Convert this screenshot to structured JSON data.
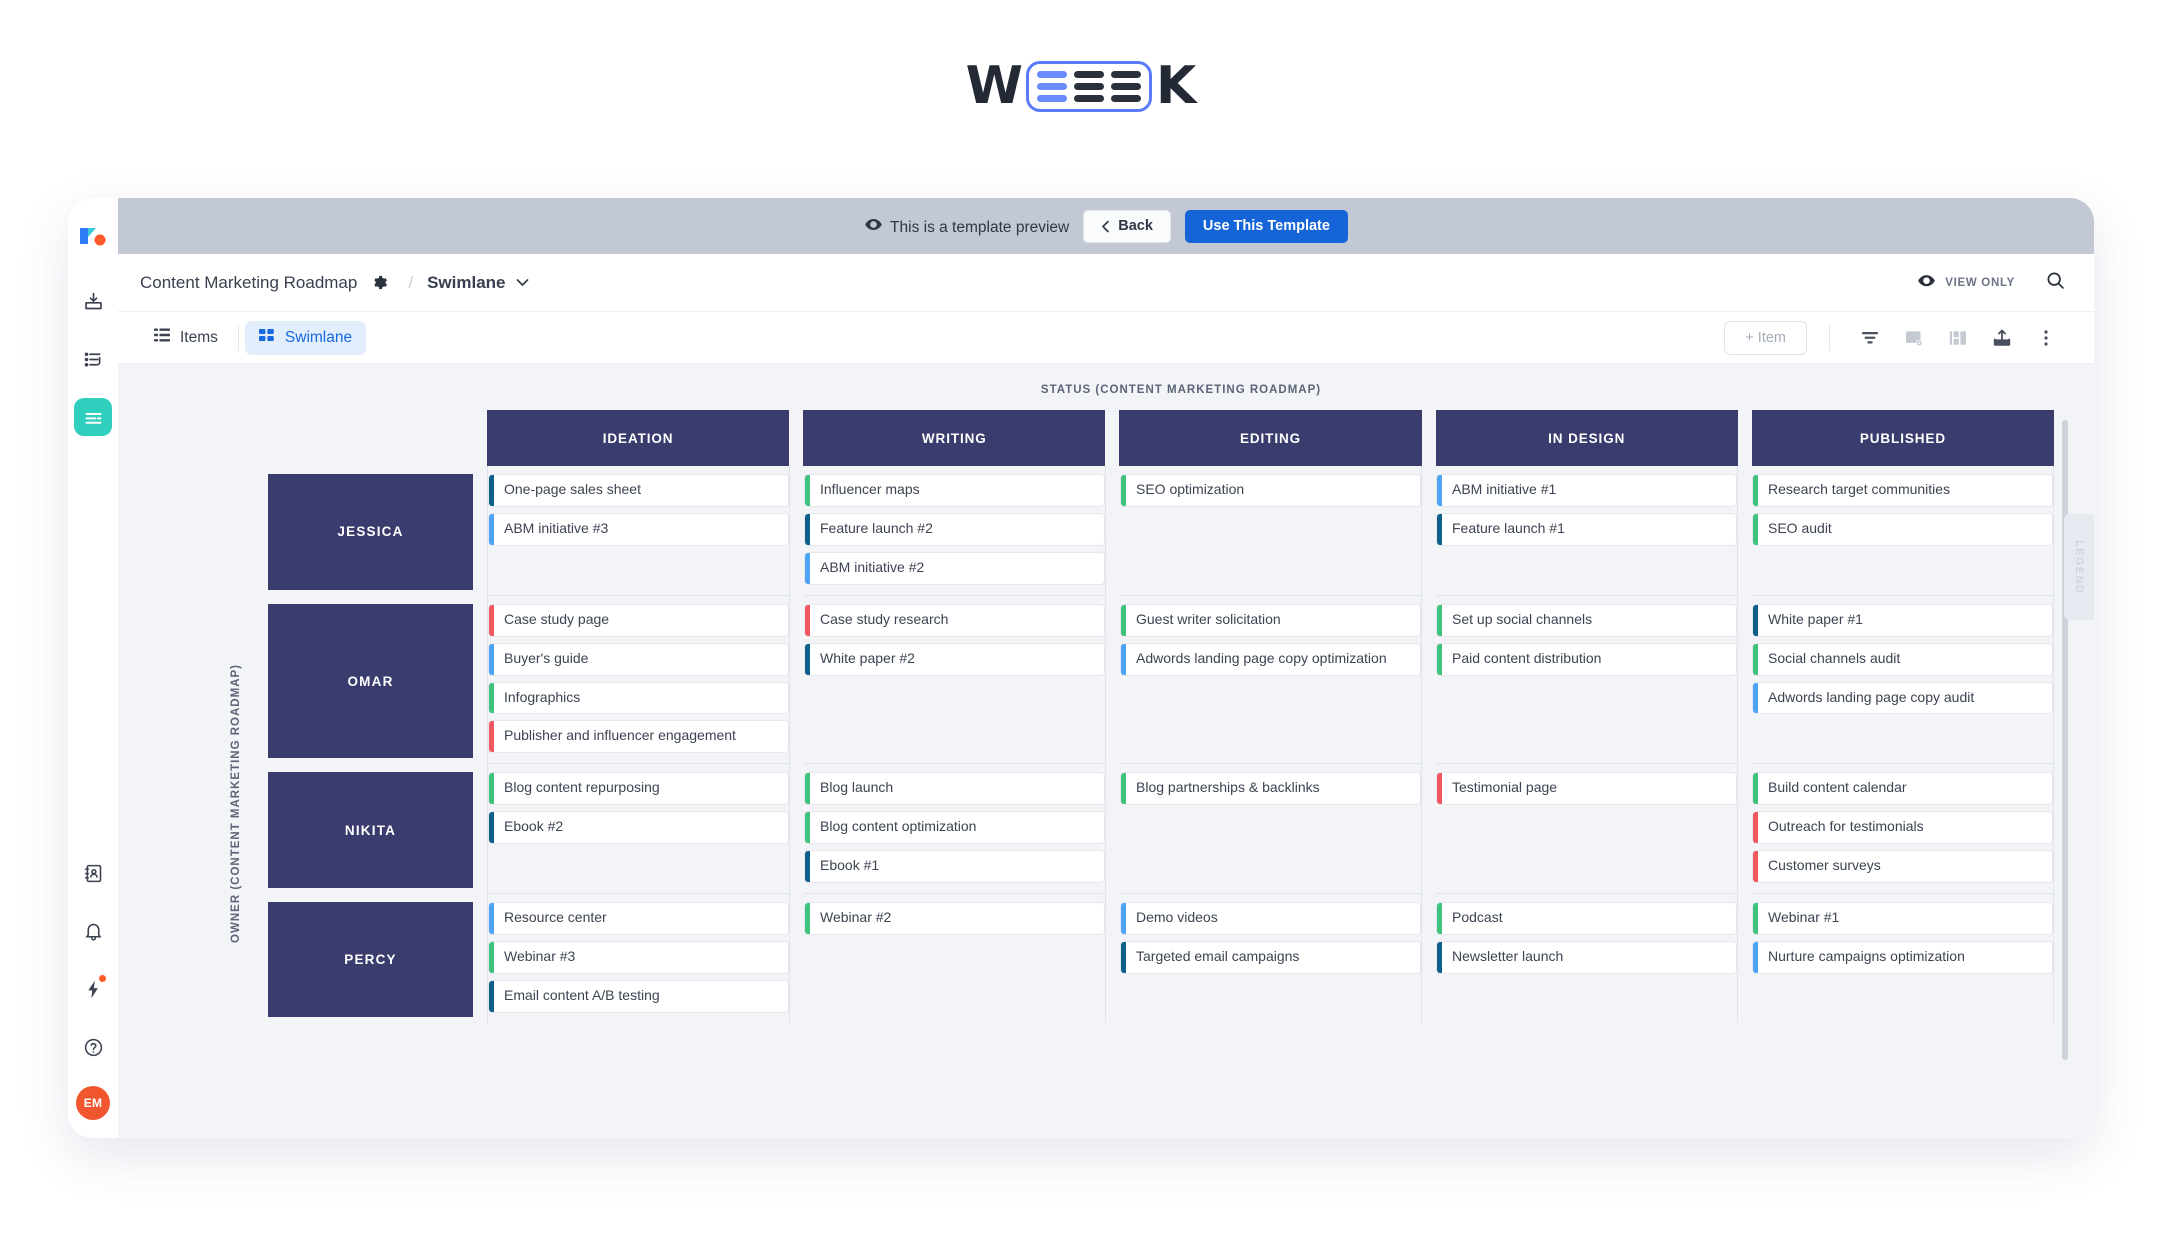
{
  "brand": {
    "pre": "W",
    "post": "K",
    "name": "WEEEK"
  },
  "preview_bar": {
    "message": "This is a template preview",
    "back_label": "Back",
    "use_label": "Use This Template"
  },
  "header": {
    "project_title": "Content Marketing Roadmap",
    "separator": "/",
    "view_name": "Swimlane",
    "view_only_label": "VIEW ONLY"
  },
  "tabs": [
    {
      "label": "Items",
      "icon": "list-icon",
      "active": false
    },
    {
      "label": "Swimlane",
      "icon": "grid-icon",
      "active": true
    }
  ],
  "toolbar": {
    "add_item_label": "+ Item",
    "icons": [
      "filter-icon",
      "card-link-icon",
      "layout-icon",
      "export-icon",
      "more-vertical-icon"
    ]
  },
  "sidebar": {
    "logo": "weeek-logo-icon",
    "items": [
      {
        "name": "inbox-download-icon",
        "active": false
      },
      {
        "name": "tasks-icon",
        "active": false
      },
      {
        "name": "board-icon",
        "active": true
      },
      {
        "name": "contacts-icon",
        "active": false
      },
      {
        "name": "notifications-bell-icon",
        "active": false
      },
      {
        "name": "automations-bolt-icon",
        "active": false,
        "badge": true
      },
      {
        "name": "help-icon",
        "active": false
      }
    ],
    "avatar_initials": "EM"
  },
  "board": {
    "title": "STATUS (CONTENT MARKETING ROADMAP)",
    "owner_axis_label": "OWNER (CONTENT MARKETING ROADMAP)",
    "legend_label": "LEGEND",
    "columns": [
      "IDEATION",
      "WRITING",
      "EDITING",
      "IN DESIGN",
      "PUBLISHED"
    ],
    "colors": {
      "navy": "#3a3c6e",
      "accent_blue": "#4da3f5",
      "accent_teal": "#0e5f8a",
      "accent_green": "#3fc27d",
      "accent_red": "#f2585f"
    },
    "lanes": [
      {
        "name": "JESSICA",
        "cells": [
          [
            {
              "text": "One-page sales sheet",
              "color": "#0e5f8a"
            },
            {
              "text": "ABM initiative #3",
              "color": "#4da3f5"
            }
          ],
          [
            {
              "text": "Influencer maps",
              "color": "#3fc27d"
            },
            {
              "text": "Feature launch #2",
              "color": "#0e5f8a"
            },
            {
              "text": "ABM initiative #2",
              "color": "#4da3f5"
            }
          ],
          [
            {
              "text": "SEO optimization",
              "color": "#3fc27d"
            }
          ],
          [
            {
              "text": "ABM initiative #1",
              "color": "#4da3f5"
            },
            {
              "text": "Feature launch #1",
              "color": "#0e5f8a"
            }
          ],
          [
            {
              "text": "Research target communities",
              "color": "#3fc27d"
            },
            {
              "text": "SEO audit",
              "color": "#3fc27d"
            }
          ]
        ]
      },
      {
        "name": "OMAR",
        "cells": [
          [
            {
              "text": "Case study page",
              "color": "#f2585f"
            },
            {
              "text": "Buyer's guide",
              "color": "#4da3f5"
            },
            {
              "text": "Infographics",
              "color": "#3fc27d"
            },
            {
              "text": "Publisher and influencer engagement",
              "color": "#f2585f"
            }
          ],
          [
            {
              "text": "Case study research",
              "color": "#f2585f"
            },
            {
              "text": "White paper #2",
              "color": "#0e5f8a"
            }
          ],
          [
            {
              "text": "Guest writer solicitation",
              "color": "#3fc27d"
            },
            {
              "text": "Adwords landing page copy optimization",
              "color": "#4da3f5"
            }
          ],
          [
            {
              "text": "Set up social channels",
              "color": "#3fc27d"
            },
            {
              "text": "Paid content distribution",
              "color": "#3fc27d"
            }
          ],
          [
            {
              "text": "White paper #1",
              "color": "#0e5f8a"
            },
            {
              "text": "Social channels audit",
              "color": "#3fc27d"
            },
            {
              "text": "Adwords landing page copy audit",
              "color": "#4da3f5"
            }
          ]
        ]
      },
      {
        "name": "NIKITA",
        "cells": [
          [
            {
              "text": "Blog content repurposing",
              "color": "#3fc27d"
            },
            {
              "text": "Ebook #2",
              "color": "#0e5f8a"
            }
          ],
          [
            {
              "text": "Blog launch",
              "color": "#3fc27d"
            },
            {
              "text": "Blog content optimization",
              "color": "#3fc27d"
            },
            {
              "text": "Ebook #1",
              "color": "#0e5f8a"
            }
          ],
          [
            {
              "text": "Blog partnerships & backlinks",
              "color": "#3fc27d"
            }
          ],
          [
            {
              "text": "Testimonial page",
              "color": "#f2585f"
            }
          ],
          [
            {
              "text": "Build content calendar",
              "color": "#3fc27d"
            },
            {
              "text": "Outreach for testimonials",
              "color": "#f2585f"
            },
            {
              "text": "Customer surveys",
              "color": "#f2585f"
            }
          ]
        ]
      },
      {
        "name": "PERCY",
        "cells": [
          [
            {
              "text": "Resource center",
              "color": "#4da3f5"
            },
            {
              "text": "Webinar #3",
              "color": "#3fc27d"
            },
            {
              "text": "Email content A/B testing",
              "color": "#0e5f8a"
            }
          ],
          [
            {
              "text": "Webinar #2",
              "color": "#3fc27d"
            }
          ],
          [
            {
              "text": "Demo videos",
              "color": "#4da3f5"
            },
            {
              "text": "Targeted email campaigns",
              "color": "#0e5f8a"
            }
          ],
          [
            {
              "text": "Podcast",
              "color": "#3fc27d"
            },
            {
              "text": "Newsletter launch",
              "color": "#0e5f8a"
            }
          ],
          [
            {
              "text": "Webinar #1",
              "color": "#3fc27d"
            },
            {
              "text": "Nurture campaigns optimization",
              "color": "#4da3f5"
            }
          ]
        ]
      }
    ]
  }
}
